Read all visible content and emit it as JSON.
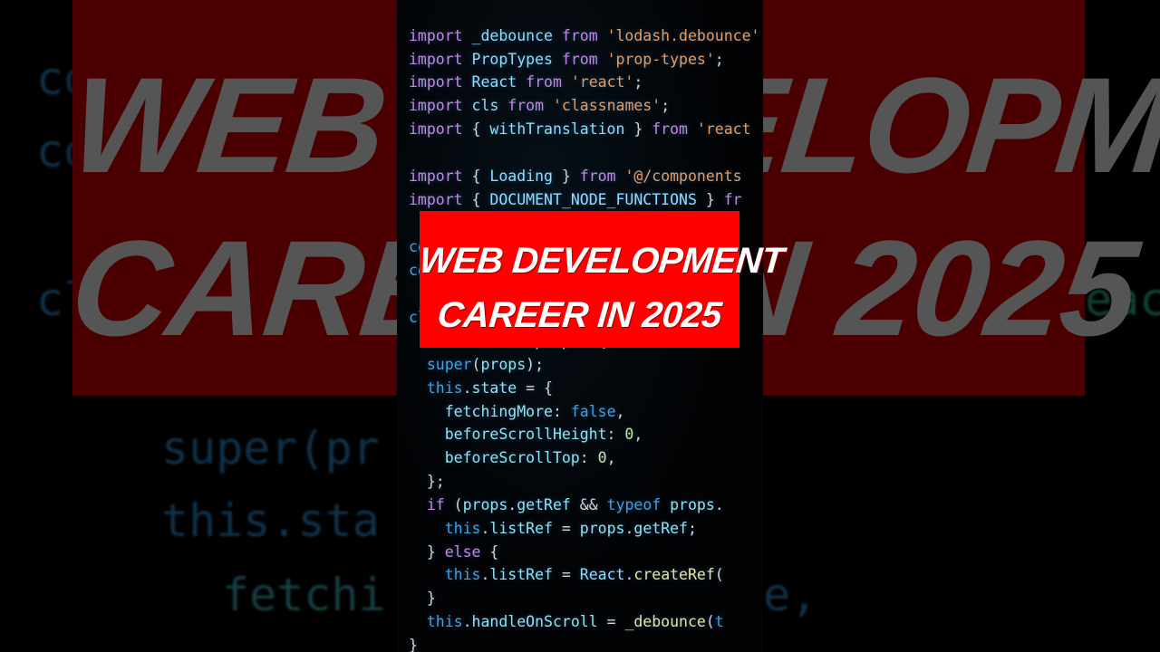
{
  "title": {
    "line1": "WEB DEVELOPMENT",
    "line2": "CAREER IN 2025"
  },
  "colors": {
    "banner_red": "#ff0000",
    "banner_text": "#ffffff",
    "background": "#000000"
  },
  "background_fragments": {
    "left": [
      "co",
      "co",
      "cl"
    ],
    "right": [
      "eac"
    ],
    "bottom": [
      "super(pr",
      "this.sta",
      "fetchi",
      "e,"
    ]
  },
  "code_lines": [
    [
      [
        "kw",
        "import "
      ],
      [
        "id",
        "_debounce "
      ],
      [
        "kw",
        "from "
      ],
      [
        "str",
        "'lodash.debounce'"
      ]
    ],
    [
      [
        "kw",
        "import "
      ],
      [
        "id",
        "PropTypes "
      ],
      [
        "kw",
        "from "
      ],
      [
        "str",
        "'prop-types'"
      ],
      [
        "pun",
        ";"
      ]
    ],
    [
      [
        "kw",
        "import "
      ],
      [
        "id",
        "React "
      ],
      [
        "kw",
        "from "
      ],
      [
        "str",
        "'react'"
      ],
      [
        "pun",
        ";"
      ]
    ],
    [
      [
        "kw",
        "import "
      ],
      [
        "id",
        "cls "
      ],
      [
        "kw",
        "from "
      ],
      [
        "str",
        "'classnames'"
      ],
      [
        "pun",
        ";"
      ]
    ],
    [
      [
        "kw",
        "import "
      ],
      [
        "pun",
        "{ "
      ],
      [
        "id",
        "withTranslation "
      ],
      [
        "pun",
        "} "
      ],
      [
        "kw",
        "from "
      ],
      [
        "str",
        "'react"
      ]
    ],
    [],
    [
      [
        "kw",
        "import "
      ],
      [
        "pun",
        "{ "
      ],
      [
        "id",
        "Loading "
      ],
      [
        "pun",
        "} "
      ],
      [
        "kw",
        "from "
      ],
      [
        "str",
        "'@/components"
      ]
    ],
    [
      [
        "kw",
        "import "
      ],
      [
        "pun",
        "{ "
      ],
      [
        "id",
        "DOCUMENT_NODE_FUNCTIONS "
      ],
      [
        "pun",
        "} "
      ],
      [
        "kw",
        "fr"
      ]
    ],
    [],
    [
      [
        "this",
        "co"
      ]
    ],
    [
      [
        "this",
        "co"
      ]
    ],
    [],
    [
      [
        "this",
        "cl"
      ],
      [
        "pun",
        "                               "
      ],
      [
        "teal",
        "eac"
      ]
    ],
    [
      [
        "pun",
        "  constructor(props) {"
      ]
    ],
    [
      [
        "this",
        "  super"
      ],
      [
        "pun",
        "("
      ],
      [
        "prop",
        "props"
      ],
      [
        "pun",
        ");"
      ]
    ],
    [
      [
        "this",
        "  this"
      ],
      [
        "pun",
        "."
      ],
      [
        "prop",
        "state "
      ],
      [
        "pun",
        "= {"
      ]
    ],
    [
      [
        "prop",
        "    fetchingMore"
      ],
      [
        "pun",
        ": "
      ],
      [
        "this",
        "false"
      ],
      [
        "pun",
        ","
      ]
    ],
    [
      [
        "prop",
        "    beforeScrollHeight"
      ],
      [
        "pun",
        ": "
      ],
      [
        "num",
        "0"
      ],
      [
        "pun",
        ","
      ]
    ],
    [
      [
        "prop",
        "    beforeScrollTop"
      ],
      [
        "pun",
        ": "
      ],
      [
        "num",
        "0"
      ],
      [
        "pun",
        ","
      ]
    ],
    [
      [
        "pun",
        "  };"
      ]
    ],
    [
      [
        "kw",
        "  if "
      ],
      [
        "pun",
        "("
      ],
      [
        "prop",
        "props"
      ],
      [
        "pun",
        "."
      ],
      [
        "prop",
        "getRef "
      ],
      [
        "pun",
        "&& "
      ],
      [
        "this",
        "typeof "
      ],
      [
        "prop",
        "props"
      ],
      [
        "pun",
        "."
      ]
    ],
    [
      [
        "this",
        "    this"
      ],
      [
        "pun",
        "."
      ],
      [
        "prop",
        "listRef "
      ],
      [
        "pun",
        "= "
      ],
      [
        "prop",
        "props"
      ],
      [
        "pun",
        "."
      ],
      [
        "prop",
        "getRef"
      ],
      [
        "pun",
        ";"
      ]
    ],
    [
      [
        "pun",
        "  } "
      ],
      [
        "kw",
        "else "
      ],
      [
        "pun",
        "{"
      ]
    ],
    [
      [
        "this",
        "    this"
      ],
      [
        "pun",
        "."
      ],
      [
        "prop",
        "listRef "
      ],
      [
        "pun",
        "= "
      ],
      [
        "id",
        "React"
      ],
      [
        "pun",
        "."
      ],
      [
        "fn",
        "createRef"
      ],
      [
        "pun",
        "("
      ]
    ],
    [
      [
        "pun",
        "  }"
      ]
    ],
    [
      [
        "this",
        "  this"
      ],
      [
        "pun",
        "."
      ],
      [
        "prop",
        "handleOnScroll "
      ],
      [
        "pun",
        "= "
      ],
      [
        "fn",
        "_debounce"
      ],
      [
        "pun",
        "("
      ],
      [
        "this",
        "t"
      ]
    ],
    [
      [
        "pun",
        "}"
      ]
    ]
  ]
}
